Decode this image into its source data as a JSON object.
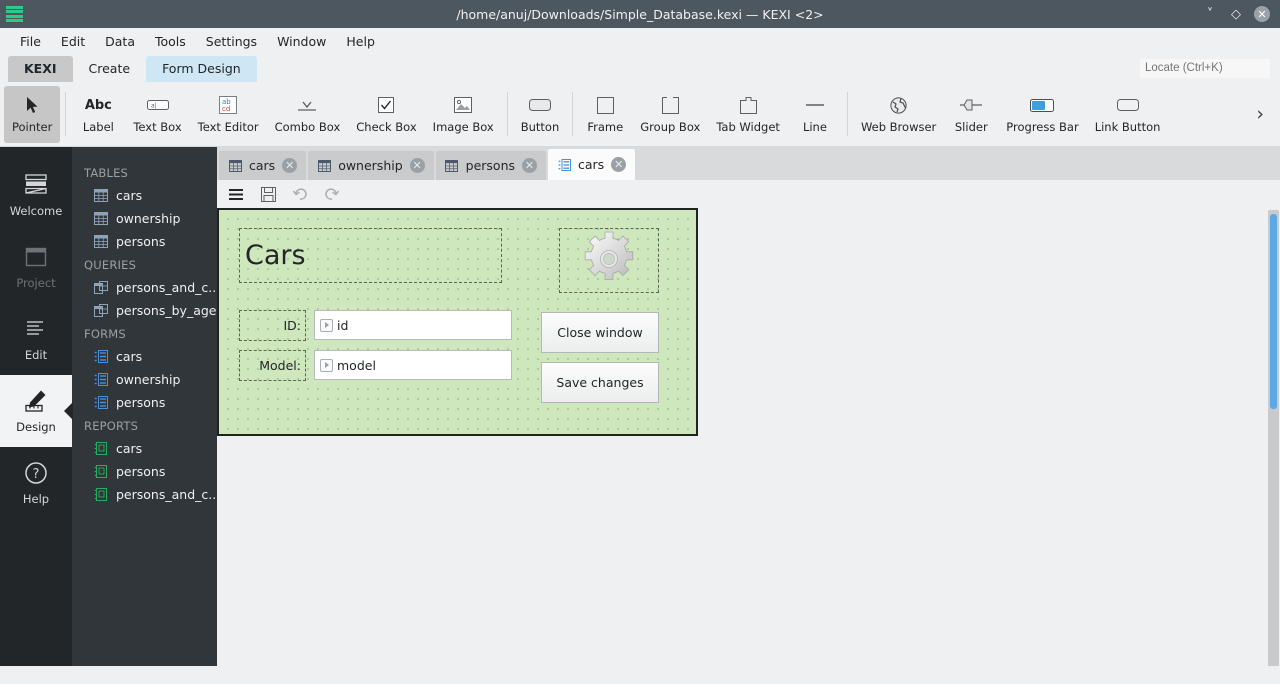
{
  "titlebar": {
    "title": "/home/anuj/Downloads/Simple_Database.kexi — KEXI <2>",
    "logo_icon": "kexi-logo-icon",
    "minimize_icon": "chevron-down-icon",
    "maximize_icon": "diamond-icon",
    "close_icon": "close-icon"
  },
  "menubar": {
    "items": [
      {
        "label": "File"
      },
      {
        "label": "Edit"
      },
      {
        "label": "Data"
      },
      {
        "label": "Tools"
      },
      {
        "label": "Settings"
      },
      {
        "label": "Window"
      },
      {
        "label": "Help"
      }
    ]
  },
  "ribbon_tabs": {
    "items": [
      {
        "label": "KEXI",
        "active": false,
        "style": "kexi"
      },
      {
        "label": "Create",
        "active": false,
        "style": "normal"
      },
      {
        "label": "Form Design",
        "active": true,
        "style": "normal"
      }
    ]
  },
  "locate": {
    "placeholder": "Locate (Ctrl+K)",
    "value": ""
  },
  "ribbon": {
    "more_icon": "chevron-right-icon",
    "tools": [
      {
        "label": "Pointer",
        "icon": "pointer-icon",
        "active": true
      },
      {
        "label": "Label",
        "icon": "abc-label-icon",
        "active": false
      },
      {
        "label": "Text Box",
        "icon": "text-box-icon",
        "active": false
      },
      {
        "label": "Text Editor",
        "icon": "text-editor-icon",
        "active": false
      },
      {
        "label": "Combo Box",
        "icon": "combo-box-icon",
        "active": false
      },
      {
        "label": "Check Box",
        "icon": "check-box-icon",
        "active": false
      },
      {
        "label": "Image Box",
        "icon": "image-box-icon",
        "active": false
      },
      {
        "label": "Button",
        "icon": "button-icon",
        "active": false
      },
      {
        "label": "Frame",
        "icon": "frame-icon",
        "active": false
      },
      {
        "label": "Group Box",
        "icon": "group-box-icon",
        "active": false
      },
      {
        "label": "Tab Widget",
        "icon": "tab-widget-icon",
        "active": false
      },
      {
        "label": "Line",
        "icon": "line-icon",
        "active": false
      },
      {
        "label": "Web Browser",
        "icon": "web-browser-icon",
        "active": false
      },
      {
        "label": "Slider",
        "icon": "slider-icon",
        "active": false
      },
      {
        "label": "Progress Bar",
        "icon": "progress-bar-icon",
        "active": false
      },
      {
        "label": "Link Button",
        "icon": "link-button-icon",
        "active": false
      }
    ]
  },
  "rail": {
    "items": [
      {
        "label": "Welcome",
        "icon": "welcome-icon",
        "state": "normal"
      },
      {
        "label": "Project",
        "icon": "project-icon",
        "state": "disabled"
      },
      {
        "label": "Edit",
        "icon": "edit-icon",
        "state": "normal"
      },
      {
        "label": "Design",
        "icon": "design-icon",
        "state": "selected"
      },
      {
        "label": "Help",
        "icon": "help-icon",
        "state": "normal"
      }
    ]
  },
  "navigator": {
    "groups": [
      {
        "title": "TABLES",
        "items": [
          {
            "label": "cars",
            "icon": "table-icon"
          },
          {
            "label": "ownership",
            "icon": "table-icon"
          },
          {
            "label": "persons",
            "icon": "table-icon"
          }
        ]
      },
      {
        "title": "QUERIES",
        "items": [
          {
            "label": "persons_and_c...",
            "icon": "query-icon"
          },
          {
            "label": "persons_by_age",
            "icon": "query-icon"
          }
        ]
      },
      {
        "title": "FORMS",
        "items": [
          {
            "label": "cars",
            "icon": "form-icon"
          },
          {
            "label": "ownership",
            "icon": "form-icon"
          },
          {
            "label": "persons",
            "icon": "form-icon"
          }
        ]
      },
      {
        "title": "REPORTS",
        "items": [
          {
            "label": "cars",
            "icon": "report-icon"
          },
          {
            "label": "persons",
            "icon": "report-icon"
          },
          {
            "label": "persons_and_c...",
            "icon": "report-icon"
          }
        ]
      }
    ]
  },
  "doctabs": {
    "close_label": "✕",
    "items": [
      {
        "label": "cars",
        "icon": "table-icon",
        "active": false
      },
      {
        "label": "ownership",
        "icon": "table-icon",
        "active": false
      },
      {
        "label": "persons",
        "icon": "table-icon",
        "active": false
      },
      {
        "label": "cars",
        "icon": "form-icon",
        "active": true
      }
    ]
  },
  "formbar": {
    "buttons": [
      {
        "icon": "hamburger-menu-icon",
        "enabled": true
      },
      {
        "icon": "save-icon",
        "enabled": true
      },
      {
        "icon": "undo-icon",
        "enabled": false
      },
      {
        "icon": "redo-icon",
        "enabled": false
      }
    ]
  },
  "form": {
    "title_widget": "Cars",
    "gear_icon": "gear-image-icon",
    "fields": [
      {
        "label": "ID:",
        "value": "id",
        "marker_icon": "data-source-marker-icon"
      },
      {
        "label": "Model:",
        "value": "model",
        "marker_icon": "data-source-marker-icon"
      }
    ],
    "buttons": [
      {
        "label": "Close window"
      },
      {
        "label": "Save changes"
      }
    ]
  },
  "colors": {
    "titlebar_bg": "#4d5760",
    "logo_green": "#30c98a",
    "ribbon_active_tab": "#cfe7f5",
    "rail_bg": "#232629",
    "nav_bg": "#31363b",
    "canvas_green": "#cfe7bd",
    "scrollbar_blue": "#5aa9e6",
    "form_icon_blue": "#4a90d9",
    "report_icon_green": "#27ae60"
  }
}
